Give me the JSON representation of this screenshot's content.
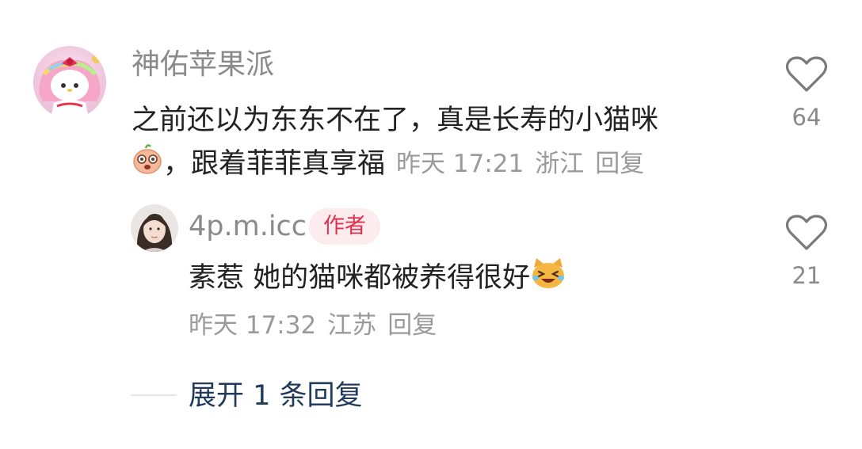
{
  "comment": {
    "username": "神佑苹果派",
    "text_line1": "之前还以为东东不在了，真是长寿的小猫咪",
    "text_line2": "，跟着菲菲真享福",
    "emoji_icon": "pig-face-emoji",
    "meta": {
      "time": "昨天 17:21",
      "location": "浙江",
      "reply_label": "回复"
    },
    "likes": "64"
  },
  "reply": {
    "username": "4p.m.icc",
    "author_badge": "作者",
    "text": "素惹 她的猫咪都被养得很好",
    "emoji_icon": "laughing-cat-emoji",
    "meta": {
      "time": "昨天 17:32",
      "location": "江苏",
      "reply_label": "回复"
    },
    "likes": "21"
  },
  "expand_label": "展开 1 条回复",
  "colors": {
    "username": "#8a8a8a",
    "text": "#222222",
    "meta": "#9a9a9a",
    "badge_bg": "#fdecee",
    "badge_text": "#e0304f",
    "expand_link": "#1f3a5c"
  }
}
